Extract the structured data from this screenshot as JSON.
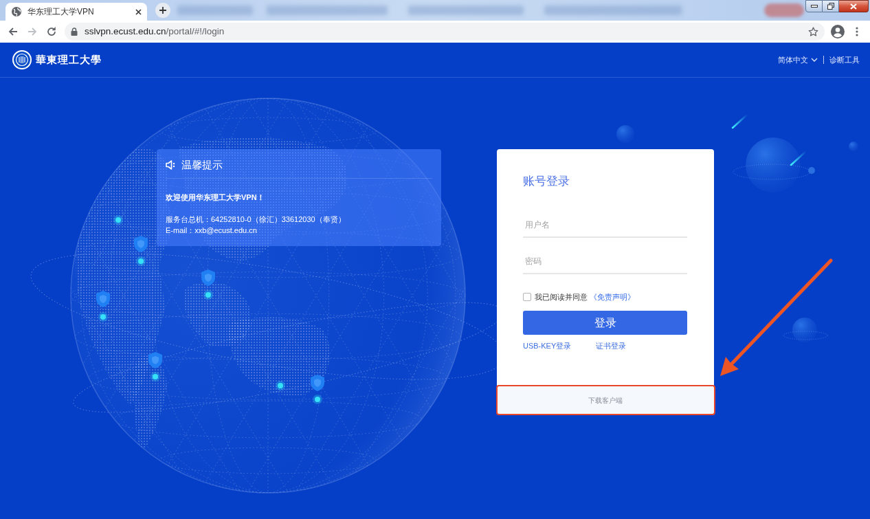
{
  "browser": {
    "tabs": [
      {
        "title": "华东理工大学VPN",
        "selected": true
      }
    ],
    "nav_buttons": [
      {
        "kind": "back",
        "disabled": false
      },
      {
        "kind": "forward",
        "disabled": true
      },
      {
        "kind": "reload",
        "disabled": false
      }
    ],
    "address_bar": {
      "host": "sslvpn.ecust.edu.cn",
      "path": "/portal/#!/login"
    }
  },
  "header": {
    "logo_text": "華東理工大學",
    "language": "简体中文",
    "tools_link": "诊断工具"
  },
  "notice": {
    "title": "温馨提示",
    "welcome": "欢迎使用华东理工大学VPN！",
    "contacts": [
      "服务台总机：64252810-0（徐汇）33612030（奉贤）",
      "E-mail：xxb@ecust.edu.cn"
    ]
  },
  "login": {
    "title": "账号登录",
    "username_field": {
      "placeholder": "用户名"
    },
    "password_field": {
      "placeholder": "密码"
    },
    "agreement": {
      "checked": false,
      "label": "我已阅读并同意",
      "link": "《免责声明》"
    },
    "submit": "登录",
    "alt_logins": [
      "USB-KEY登录",
      "证书登录"
    ],
    "download": {
      "label": "下载客户端",
      "highlighted": true
    }
  }
}
